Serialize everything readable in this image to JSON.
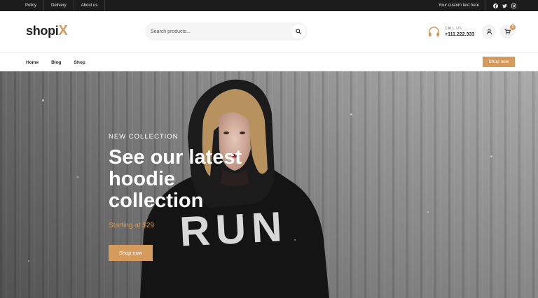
{
  "topbar": {
    "links": [
      "Policy",
      "Delivery",
      "About us"
    ],
    "custom_text": "Your custom text here",
    "social": [
      "facebook-icon",
      "twitter-icon",
      "instagram-icon"
    ]
  },
  "header": {
    "logo_main": "shopi",
    "logo_accent": "X",
    "search_placeholder": "Search products...",
    "call_label": "CALL US",
    "phone": "+111.222.333",
    "cart_count": "0"
  },
  "nav": {
    "items": [
      "Home",
      "Blog",
      "Shop"
    ],
    "cta": "Shop now"
  },
  "hero": {
    "eyebrow": "NEW COLLECTION",
    "headline_lines": [
      "See our latest",
      "hoodie",
      "collection"
    ],
    "price_text": "Starting at $29",
    "button": "Shop now",
    "hoodie_print": "RUN"
  },
  "colors": {
    "accent": "#d59b5c",
    "topbar_bg": "#1c1c1c",
    "text_dark": "#222222"
  }
}
